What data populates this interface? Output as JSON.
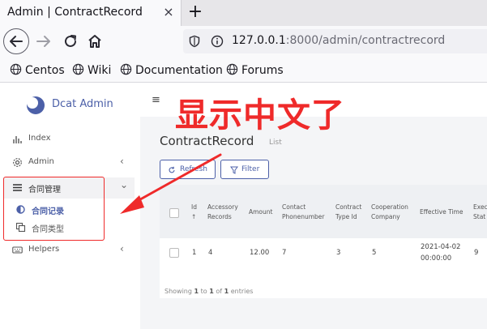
{
  "browser": {
    "tab_title": "Admin | ContractRecord",
    "tab_close": "×",
    "new_tab": "+",
    "url_host": "127.0.0.1",
    "url_rest": ":8000/admin/contractrecord",
    "bookmarks": [
      {
        "label": "Centos"
      },
      {
        "label": "Wiki"
      },
      {
        "label": "Documentation"
      },
      {
        "label": "Forums"
      }
    ]
  },
  "sidebar": {
    "brand": "Dcat Admin",
    "items": [
      {
        "label": "Index",
        "icon": "bar-chart-icon"
      },
      {
        "label": "Admin",
        "icon": "gear-icon",
        "arrow": "‹"
      },
      {
        "label": "合同管理",
        "icon": "list-icon",
        "arrow": "⌄"
      },
      {
        "label": "合同记录",
        "icon": "half-circle-icon"
      },
      {
        "label": "合同类型",
        "icon": "copy-icon"
      },
      {
        "label": "Helpers",
        "icon": "keyboard-icon",
        "arrow": "‹"
      }
    ]
  },
  "topbar": {
    "menu_toggle": "≡"
  },
  "main": {
    "title": "ContractRecord",
    "subtitle": "List",
    "refresh_label": "Refresh",
    "filter_label": "Filter",
    "columns": [
      {
        "line1": "Id",
        "line2": "↑"
      },
      {
        "line1": "Accessory",
        "line2": "Records"
      },
      {
        "line1": "Amount",
        "line2": ""
      },
      {
        "line1": "Contact",
        "line2": "Phonenumber"
      },
      {
        "line1": "Contract",
        "line2": "Type Id"
      },
      {
        "line1": "Cooperation",
        "line2": "Company"
      },
      {
        "line1": "Effective Time",
        "line2": ""
      },
      {
        "line1": "Exec",
        "line2": "Stat"
      }
    ],
    "row": {
      "id": "1",
      "accessory": "4",
      "amount": "12.00",
      "phone": "7",
      "type_id": "3",
      "company": "5",
      "time_line1": "2021-04-02",
      "time_line2": "00:00:00",
      "exec": "9"
    },
    "footer": {
      "prefix": "Showing ",
      "from": "1",
      "to_word": " to ",
      "to": "1",
      "of_word": " of ",
      "total": "1",
      "suffix": " entries"
    }
  },
  "annotation": {
    "text": "显示中文了",
    "color": "#ef2a2a"
  },
  "colors": {
    "accent": "#4c60a8",
    "annotation": "#ef2a2a"
  }
}
